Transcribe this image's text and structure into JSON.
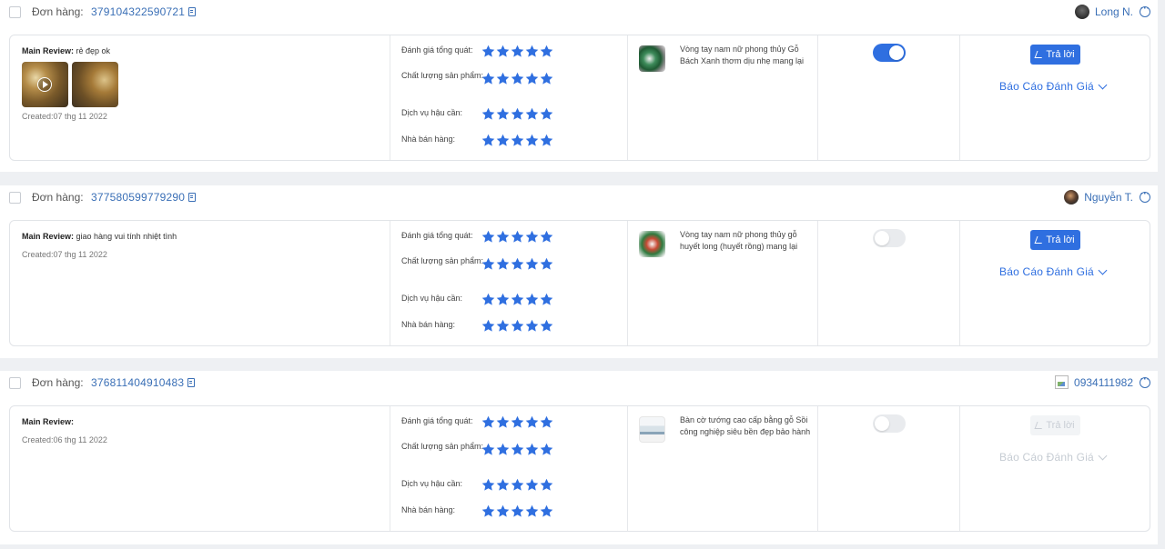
{
  "labels": {
    "order": "Đơn hàng:",
    "main_review": "Main Review:",
    "reply": "Trả lời",
    "report": "Báo Cáo Đánh Giá"
  },
  "rating_labels": [
    "Đánh giá tổng quát:",
    "Chất lượng sản phẩm:",
    "Dịch vụ hậu cần:",
    "Nhà bán hàng:"
  ],
  "colors": {
    "accent": "#2f6fe0",
    "link": "#3a6fb6",
    "star": "#2f6fe0"
  },
  "orders": [
    {
      "order_id": "379104322590721",
      "user": "Long N.",
      "review_text": "rẻ đẹp ok",
      "created": "Created:07 thg 11 2022",
      "ratings": [
        5,
        5,
        5,
        5
      ],
      "product_name": "Vòng tay nam nữ phong thủy Gỗ Bách Xanh thơm dịu nhẹ mang lại may",
      "visible": true,
      "reply_enabled": true
    },
    {
      "order_id": "377580599779290",
      "user": "Nguyễn T.",
      "review_text": "giao hàng vui tính nhiệt tình",
      "created": "Created:07 thg 11 2022",
      "ratings": [
        5,
        5,
        5,
        5
      ],
      "product_name": "Vòng tay nam nữ phong thủy gỗ huyết long (huyết rồng) mang lại may",
      "visible": false,
      "reply_enabled": true
    },
    {
      "order_id": "376811404910483",
      "user": "0934111982",
      "review_text": "",
      "created": "Created:06 thg 11 2022",
      "ratings": [
        5,
        5,
        5,
        5
      ],
      "product_name": "Bàn cờ tướng cao cấp bằng gỗ Sồi công nghiệp siêu bền đẹp bảo hành",
      "visible": false,
      "reply_enabled": false
    }
  ]
}
